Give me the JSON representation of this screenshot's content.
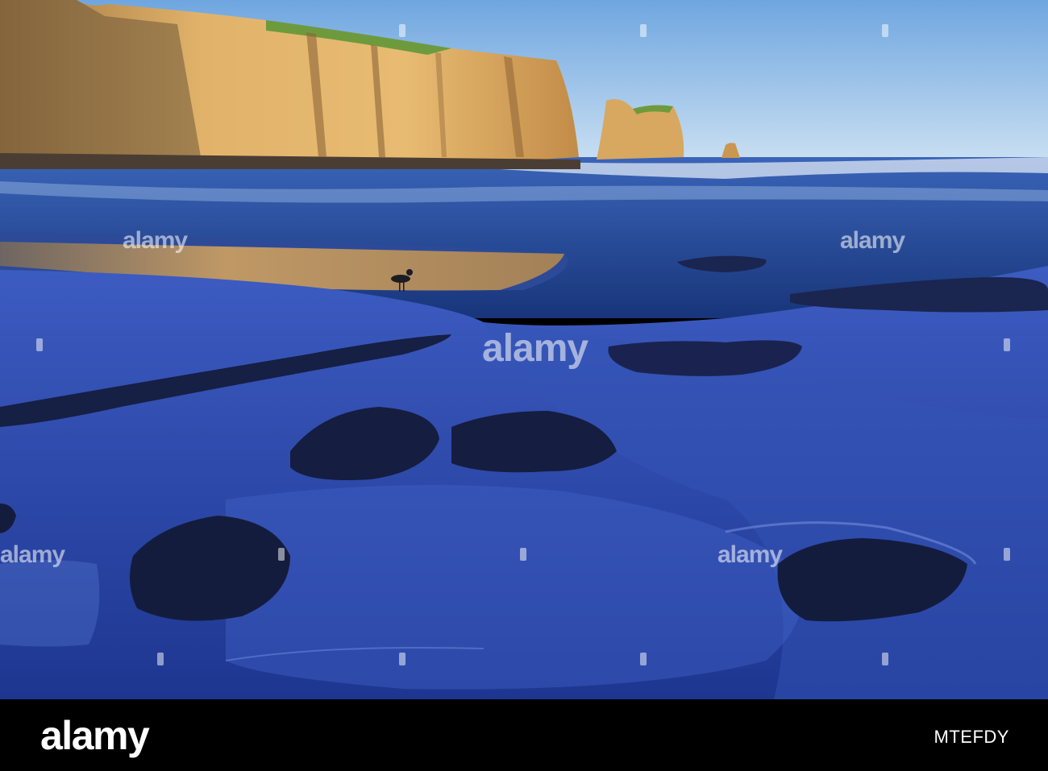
{
  "watermark": {
    "brand": "alamy"
  },
  "footer": {
    "logo": "alamy",
    "image_id": "MTEFDY"
  },
  "colors": {
    "sky": "#9cc6ec",
    "cliff": "#d9a85a",
    "sea": "#1f3f8a",
    "sand": "#2a4aa8",
    "footer_bg": "#000000"
  }
}
